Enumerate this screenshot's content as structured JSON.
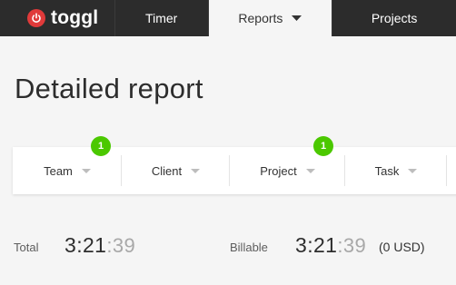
{
  "app": {
    "brand": "toggl"
  },
  "nav": {
    "tabs": [
      {
        "label": "Timer"
      },
      {
        "label": "Reports"
      },
      {
        "label": "Projects"
      }
    ]
  },
  "page": {
    "title": "Detailed report"
  },
  "filters": {
    "team": {
      "label": "Team",
      "badge": "1"
    },
    "client": {
      "label": "Client"
    },
    "project": {
      "label": "Project",
      "badge": "1"
    },
    "task": {
      "label": "Task"
    }
  },
  "totals": {
    "total_label": "Total",
    "total_hm": "3:21",
    "total_sec": ":39",
    "billable_label": "Billable",
    "billable_hm": "3:21",
    "billable_sec": ":39",
    "billable_amount": "(0 USD)"
  },
  "colors": {
    "topbar": "#2c2c2c",
    "brand_red": "#e03a3a",
    "badge_green": "#4bc800",
    "background": "#f5f5f5"
  },
  "icons": [
    "power-icon",
    "chevron-down-icon"
  ]
}
